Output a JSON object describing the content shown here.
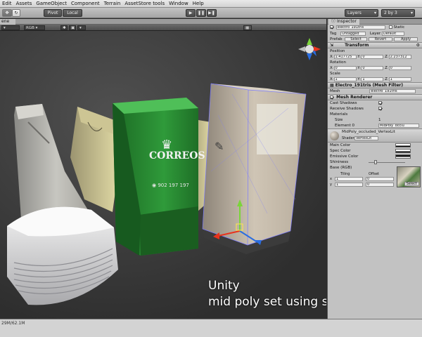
{
  "menu": [
    "Edit",
    "Assets",
    "GameObject",
    "Component",
    "Terrain",
    "AssetStore tools",
    "Window",
    "Help"
  ],
  "toolbar": {
    "pivot_label": "Pivot",
    "local_label": "Local",
    "layers_label": "Layers",
    "layout_label": "2 by 3"
  },
  "scene": {
    "tab_label": "ene",
    "render_mode": "RGB",
    "caption_line1": "Unity",
    "caption_line2": "mid poly set using sigle texture"
  },
  "inspector": {
    "tab_label": "Inspector",
    "object_name": "electro_191tris",
    "static_label": "Static",
    "tag_label": "Tag",
    "tag_value": "Untagged",
    "layer_label": "Layer",
    "layer_value": "Default",
    "prefab_label": "Prefab",
    "select_label": "Select",
    "revert_label": "Revert",
    "apply_label": "Apply",
    "transform": {
      "title": "Transform",
      "position_label": "Position",
      "position": {
        "x": "1.417725",
        "y": "0",
        "z": "2.237312"
      },
      "rotation_label": "Rotation",
      "rotation": {
        "x": "0",
        "y": "0",
        "z": "0"
      },
      "scale_label": "Scale",
      "scale": {
        "x": "1",
        "y": "1",
        "z": "1"
      }
    },
    "mesh_filter": {
      "title": "Electro_191tris (Mesh Filter)",
      "mesh_label": "Mesh",
      "mesh_value": "electro_191tris"
    },
    "mesh_renderer": {
      "title": "Mesh Renderer",
      "cast_label": "Cast Shadows",
      "receive_label": "Receive Shadows",
      "materials_label": "Materials",
      "size_label": "Size",
      "size_value": "1",
      "element_label": "Element 0",
      "element_value": "MidPoly_occlu"
    },
    "material": {
      "name": "MidPoly_occluded_VertexLit",
      "shader_label": "Shader",
      "shader_value": "VertexLit",
      "main_color": "Main Color",
      "spec_color": "Spec Color",
      "emissive_color": "Emissive Color",
      "shininess": "Shininess",
      "base_label": "Base (RGB)",
      "tiling_label": "Tiling",
      "offset_label": "Offset",
      "tiling": {
        "x": "1",
        "y": "1"
      },
      "offset": {
        "x": "0",
        "y": "0"
      },
      "select_tex": "Select"
    }
  },
  "status": {
    "text": "29M/62.1M"
  }
}
